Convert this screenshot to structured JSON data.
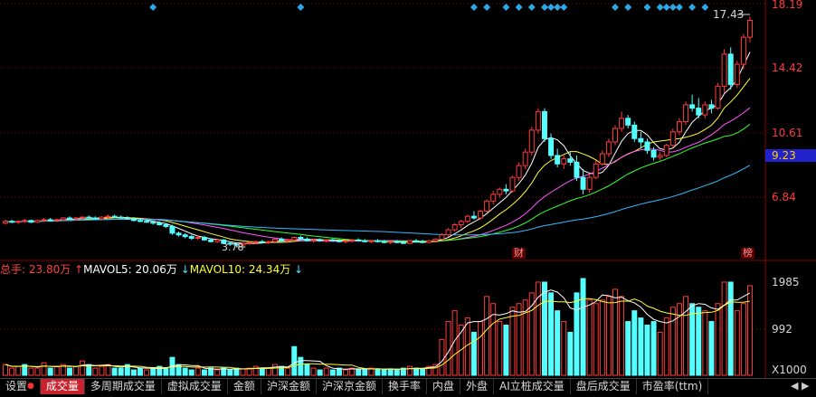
{
  "price_axis": {
    "labels": [
      "18.19",
      "14.42",
      "10.61",
      "6.84"
    ],
    "current": "9.23"
  },
  "chart_annotations": {
    "high_label": "17.43",
    "low_label": "3.78",
    "event_cai": "财",
    "event_bang": "榜"
  },
  "volume": {
    "legend": {
      "total_label": "总手: ",
      "total_value": "23.80万",
      "mavol5_label": "MAVOL5: ",
      "mavol5_value": "20.06万",
      "mavol10_label": "MAVOL10: ",
      "mavol10_value": "24.34万"
    },
    "axis": [
      "1985",
      "992",
      "X1000"
    ]
  },
  "tabs": {
    "settings": "设置",
    "items": [
      "成交量",
      "多周期成交量",
      "虚拟成交量",
      "金额",
      "沪深金额",
      "沪深京金额",
      "换手率",
      "内盘",
      "外盘",
      "AI立桩成交量",
      "盘后成交量",
      "市盈率(ttm)"
    ]
  },
  "colors": {
    "up": "#ff3b3b",
    "down": "#55ffff",
    "ma5": "#ffffff",
    "ma10": "#ffff33",
    "ma20": "#ff55ff",
    "ma30": "#33ff33",
    "ma60": "#33bbff",
    "grid": "#8b0000",
    "diamond": "#2aa8e8"
  },
  "chart_data": {
    "type": "candlestick",
    "price_range": [
      3.2,
      18.19
    ],
    "candles": [
      [
        5.2,
        5.4,
        5.1,
        5.3
      ],
      [
        5.3,
        5.4,
        5.2,
        5.25
      ],
      [
        5.25,
        5.35,
        5.15,
        5.3
      ],
      [
        5.3,
        5.45,
        5.2,
        5.35
      ],
      [
        5.35,
        5.4,
        5.2,
        5.25
      ],
      [
        5.25,
        5.4,
        5.2,
        5.35
      ],
      [
        5.35,
        5.5,
        5.25,
        5.4
      ],
      [
        5.4,
        5.5,
        5.3,
        5.35
      ],
      [
        5.35,
        5.45,
        5.25,
        5.4
      ],
      [
        5.4,
        5.55,
        5.35,
        5.5
      ],
      [
        5.5,
        5.6,
        5.4,
        5.45
      ],
      [
        5.45,
        5.55,
        5.35,
        5.5
      ],
      [
        5.5,
        5.6,
        5.4,
        5.55
      ],
      [
        5.55,
        5.65,
        5.45,
        5.5
      ],
      [
        5.5,
        5.6,
        5.4,
        5.45
      ],
      [
        5.45,
        5.6,
        5.4,
        5.55
      ],
      [
        5.55,
        5.7,
        5.45,
        5.6
      ],
      [
        5.6,
        5.7,
        5.5,
        5.55
      ],
      [
        5.55,
        5.65,
        5.45,
        5.5
      ],
      [
        5.5,
        5.6,
        5.4,
        5.45
      ],
      [
        5.45,
        5.55,
        5.3,
        5.35
      ],
      [
        5.35,
        5.45,
        5.25,
        5.3
      ],
      [
        5.3,
        5.4,
        5.2,
        5.25
      ],
      [
        5.25,
        5.35,
        5.1,
        5.2
      ],
      [
        5.2,
        5.3,
        5.05,
        5.1
      ],
      [
        5.1,
        5.2,
        4.9,
        5.0
      ],
      [
        5.0,
        5.1,
        4.5,
        4.6
      ],
      [
        4.6,
        4.7,
        4.4,
        4.5
      ],
      [
        4.5,
        4.6,
        4.3,
        4.4
      ],
      [
        4.4,
        4.5,
        4.2,
        4.3
      ],
      [
        4.3,
        4.45,
        4.2,
        4.35
      ],
      [
        4.35,
        4.45,
        4.15,
        4.2
      ],
      [
        4.2,
        4.3,
        4.05,
        4.1
      ],
      [
        4.1,
        4.25,
        4.0,
        4.2
      ],
      [
        4.2,
        4.25,
        3.95,
        4.0
      ],
      [
        4.0,
        4.1,
        3.85,
        3.95
      ],
      [
        3.95,
        4.05,
        3.78,
        3.9
      ],
      [
        3.9,
        4.05,
        3.85,
        4.0
      ],
      [
        4.0,
        4.1,
        3.9,
        4.05
      ],
      [
        4.05,
        4.15,
        3.95,
        4.1
      ],
      [
        4.1,
        4.2,
        4.0,
        4.05
      ],
      [
        4.05,
        4.15,
        3.95,
        4.1
      ],
      [
        4.1,
        4.3,
        4.05,
        4.25
      ],
      [
        4.25,
        4.35,
        4.1,
        4.15
      ],
      [
        4.15,
        4.25,
        4.05,
        4.2
      ],
      [
        4.2,
        4.4,
        4.15,
        4.35
      ],
      [
        4.35,
        4.45,
        4.2,
        4.25
      ],
      [
        4.25,
        4.35,
        4.1,
        4.15
      ],
      [
        4.15,
        4.25,
        4.05,
        4.2
      ],
      [
        4.2,
        4.3,
        4.1,
        4.15
      ],
      [
        4.15,
        4.25,
        4.05,
        4.2
      ],
      [
        4.2,
        4.3,
        4.1,
        4.15
      ],
      [
        4.15,
        4.25,
        4.05,
        4.1
      ],
      [
        4.1,
        4.2,
        4.0,
        4.15
      ],
      [
        4.15,
        4.25,
        4.05,
        4.2
      ],
      [
        4.2,
        4.3,
        4.1,
        4.15
      ],
      [
        4.15,
        4.25,
        4.05,
        4.1
      ],
      [
        4.1,
        4.2,
        4.0,
        4.15
      ],
      [
        4.15,
        4.25,
        4.05,
        4.1
      ],
      [
        4.1,
        4.2,
        4.0,
        4.05
      ],
      [
        4.05,
        4.15,
        3.95,
        4.1
      ],
      [
        4.1,
        4.2,
        4.0,
        4.05
      ],
      [
        4.05,
        4.15,
        3.95,
        4.0
      ],
      [
        4.0,
        4.2,
        3.95,
        4.15
      ],
      [
        4.15,
        4.25,
        4.05,
        4.1
      ],
      [
        4.1,
        4.2,
        4.0,
        4.05
      ],
      [
        4.05,
        4.2,
        4.0,
        4.15
      ],
      [
        4.15,
        4.3,
        4.1,
        4.25
      ],
      [
        4.25,
        4.6,
        4.2,
        4.5
      ],
      [
        4.5,
        4.9,
        4.4,
        4.8
      ],
      [
        4.8,
        5.2,
        4.7,
        5.1
      ],
      [
        5.1,
        5.4,
        4.9,
        5.3
      ],
      [
        5.3,
        5.7,
        5.2,
        5.6
      ],
      [
        5.6,
        5.9,
        5.4,
        5.5
      ],
      [
        5.5,
        6.0,
        5.4,
        5.9
      ],
      [
        5.9,
        6.6,
        5.8,
        6.5
      ],
      [
        6.5,
        7.1,
        6.3,
        6.9
      ],
      [
        6.9,
        7.3,
        6.7,
        7.2
      ],
      [
        7.2,
        7.5,
        6.9,
        7.1
      ],
      [
        7.1,
        8.0,
        7.0,
        7.9
      ],
      [
        7.9,
        8.8,
        7.7,
        8.6
      ],
      [
        8.6,
        9.6,
        8.4,
        9.4
      ],
      [
        9.4,
        10.9,
        9.2,
        10.7
      ],
      [
        10.7,
        12.0,
        10.5,
        11.8
      ],
      [
        11.8,
        12.0,
        10.0,
        10.2
      ],
      [
        10.2,
        10.5,
        9.0,
        9.2
      ],
      [
        9.2,
        9.6,
        8.5,
        8.7
      ],
      [
        8.7,
        9.2,
        8.4,
        9.0
      ],
      [
        9.0,
        9.4,
        8.6,
        8.8
      ],
      [
        8.8,
        9.2,
        7.7,
        7.9
      ],
      [
        7.9,
        8.4,
        6.9,
        7.2
      ],
      [
        7.2,
        8.1,
        7.0,
        7.9
      ],
      [
        7.9,
        8.9,
        7.8,
        8.7
      ],
      [
        8.7,
        9.5,
        8.6,
        9.3
      ],
      [
        9.3,
        10.2,
        9.1,
        10.0
      ],
      [
        10.0,
        11.0,
        9.8,
        10.8
      ],
      [
        10.8,
        11.8,
        10.6,
        11.4
      ],
      [
        11.4,
        11.6,
        10.8,
        11.0
      ],
      [
        11.0,
        11.2,
        10.0,
        10.2
      ],
      [
        10.2,
        10.6,
        9.6,
        10.0
      ],
      [
        10.0,
        10.2,
        9.3,
        9.5
      ],
      [
        9.5,
        9.7,
        8.9,
        9.1
      ],
      [
        9.1,
        9.4,
        8.9,
        9.2
      ],
      [
        9.2,
        9.9,
        9.1,
        9.8
      ],
      [
        9.8,
        10.8,
        9.7,
        10.6
      ],
      [
        10.6,
        11.4,
        10.4,
        11.2
      ],
      [
        11.2,
        12.4,
        11.0,
        12.2
      ],
      [
        12.2,
        12.8,
        11.8,
        12.0
      ],
      [
        12.0,
        12.6,
        11.4,
        11.6
      ],
      [
        11.6,
        12.4,
        11.4,
        12.2
      ],
      [
        12.2,
        12.5,
        11.7,
        12.0
      ],
      [
        12.0,
        13.5,
        11.9,
        13.3
      ],
      [
        13.3,
        15.5,
        12.9,
        15.2
      ],
      [
        15.2,
        15.6,
        13.1,
        13.4
      ],
      [
        13.4,
        14.8,
        13.2,
        14.6
      ],
      [
        14.6,
        16.4,
        14.3,
        16.2
      ],
      [
        16.2,
        17.43,
        15.9,
        17.2
      ]
    ],
    "volumes": [
      [
        0.3,
        1
      ],
      [
        0.2,
        1
      ],
      [
        0.25,
        1
      ],
      [
        0.3,
        0
      ],
      [
        0.2,
        1
      ],
      [
        0.2,
        1
      ],
      [
        0.35,
        1
      ],
      [
        0.2,
        0
      ],
      [
        0.25,
        1
      ],
      [
        0.3,
        1
      ],
      [
        0.2,
        0
      ],
      [
        0.25,
        1
      ],
      [
        0.4,
        1
      ],
      [
        0.3,
        0
      ],
      [
        0.2,
        1
      ],
      [
        0.25,
        1
      ],
      [
        0.3,
        1
      ],
      [
        0.2,
        0
      ],
      [
        0.2,
        0
      ],
      [
        0.3,
        0
      ],
      [
        0.15,
        0
      ],
      [
        0.2,
        0
      ],
      [
        0.15,
        1
      ],
      [
        0.2,
        0
      ],
      [
        0.25,
        0
      ],
      [
        0.2,
        0
      ],
      [
        0.5,
        0
      ],
      [
        0.3,
        0
      ],
      [
        0.2,
        0
      ],
      [
        0.15,
        0
      ],
      [
        0.2,
        1
      ],
      [
        0.15,
        0
      ],
      [
        0.2,
        0
      ],
      [
        0.15,
        1
      ],
      [
        0.2,
        0
      ],
      [
        0.15,
        0
      ],
      [
        0.2,
        0
      ],
      [
        0.18,
        1
      ],
      [
        0.2,
        1
      ],
      [
        0.25,
        1
      ],
      [
        0.2,
        0
      ],
      [
        0.2,
        1
      ],
      [
        0.3,
        1
      ],
      [
        0.25,
        0
      ],
      [
        0.2,
        1
      ],
      [
        0.8,
        0
      ],
      [
        0.5,
        0
      ],
      [
        0.3,
        0
      ],
      [
        0.2,
        1
      ],
      [
        0.15,
        0
      ],
      [
        0.2,
        1
      ],
      [
        0.15,
        0
      ],
      [
        0.2,
        0
      ],
      [
        0.15,
        1
      ],
      [
        0.2,
        1
      ],
      [
        0.18,
        0
      ],
      [
        0.15,
        0
      ],
      [
        0.2,
        1
      ],
      [
        0.18,
        0
      ],
      [
        0.15,
        0
      ],
      [
        0.18,
        0
      ],
      [
        0.15,
        0
      ],
      [
        0.2,
        0
      ],
      [
        0.25,
        1
      ],
      [
        0.2,
        0
      ],
      [
        0.18,
        0
      ],
      [
        0.25,
        1
      ],
      [
        0.3,
        1
      ],
      [
        1.0,
        1
      ],
      [
        1.5,
        1
      ],
      [
        1.8,
        1
      ],
      [
        1.4,
        1
      ],
      [
        1.6,
        1
      ],
      [
        1.2,
        0
      ],
      [
        1.5,
        1
      ],
      [
        2.2,
        1
      ],
      [
        2.0,
        1
      ],
      [
        1.5,
        1
      ],
      [
        1.4,
        0
      ],
      [
        1.9,
        1
      ],
      [
        2.0,
        1
      ],
      [
        2.1,
        1
      ],
      [
        2.3,
        1
      ],
      [
        2.6,
        1
      ],
      [
        2.6,
        0
      ],
      [
        2.3,
        0
      ],
      [
        1.8,
        0
      ],
      [
        1.5,
        1
      ],
      [
        1.2,
        0
      ],
      [
        2.3,
        0
      ],
      [
        2.7,
        0
      ],
      [
        2.1,
        1
      ],
      [
        2.0,
        1
      ],
      [
        2.1,
        1
      ],
      [
        2.2,
        1
      ],
      [
        2.4,
        1
      ],
      [
        2.2,
        1
      ],
      [
        1.5,
        0
      ],
      [
        1.8,
        0
      ],
      [
        1.6,
        0
      ],
      [
        1.4,
        0
      ],
      [
        1.5,
        0
      ],
      [
        1.2,
        1
      ],
      [
        1.6,
        1
      ],
      [
        1.9,
        1
      ],
      [
        2.0,
        1
      ],
      [
        2.2,
        1
      ],
      [
        2.0,
        0
      ],
      [
        1.9,
        0
      ],
      [
        1.8,
        1
      ],
      [
        1.5,
        0
      ],
      [
        2.0,
        1
      ],
      [
        2.6,
        1
      ],
      [
        2.6,
        0
      ],
      [
        1.8,
        1
      ],
      [
        2.0,
        1
      ],
      [
        2.5,
        1
      ]
    ],
    "volume_range": [
      0,
      2700
    ]
  }
}
